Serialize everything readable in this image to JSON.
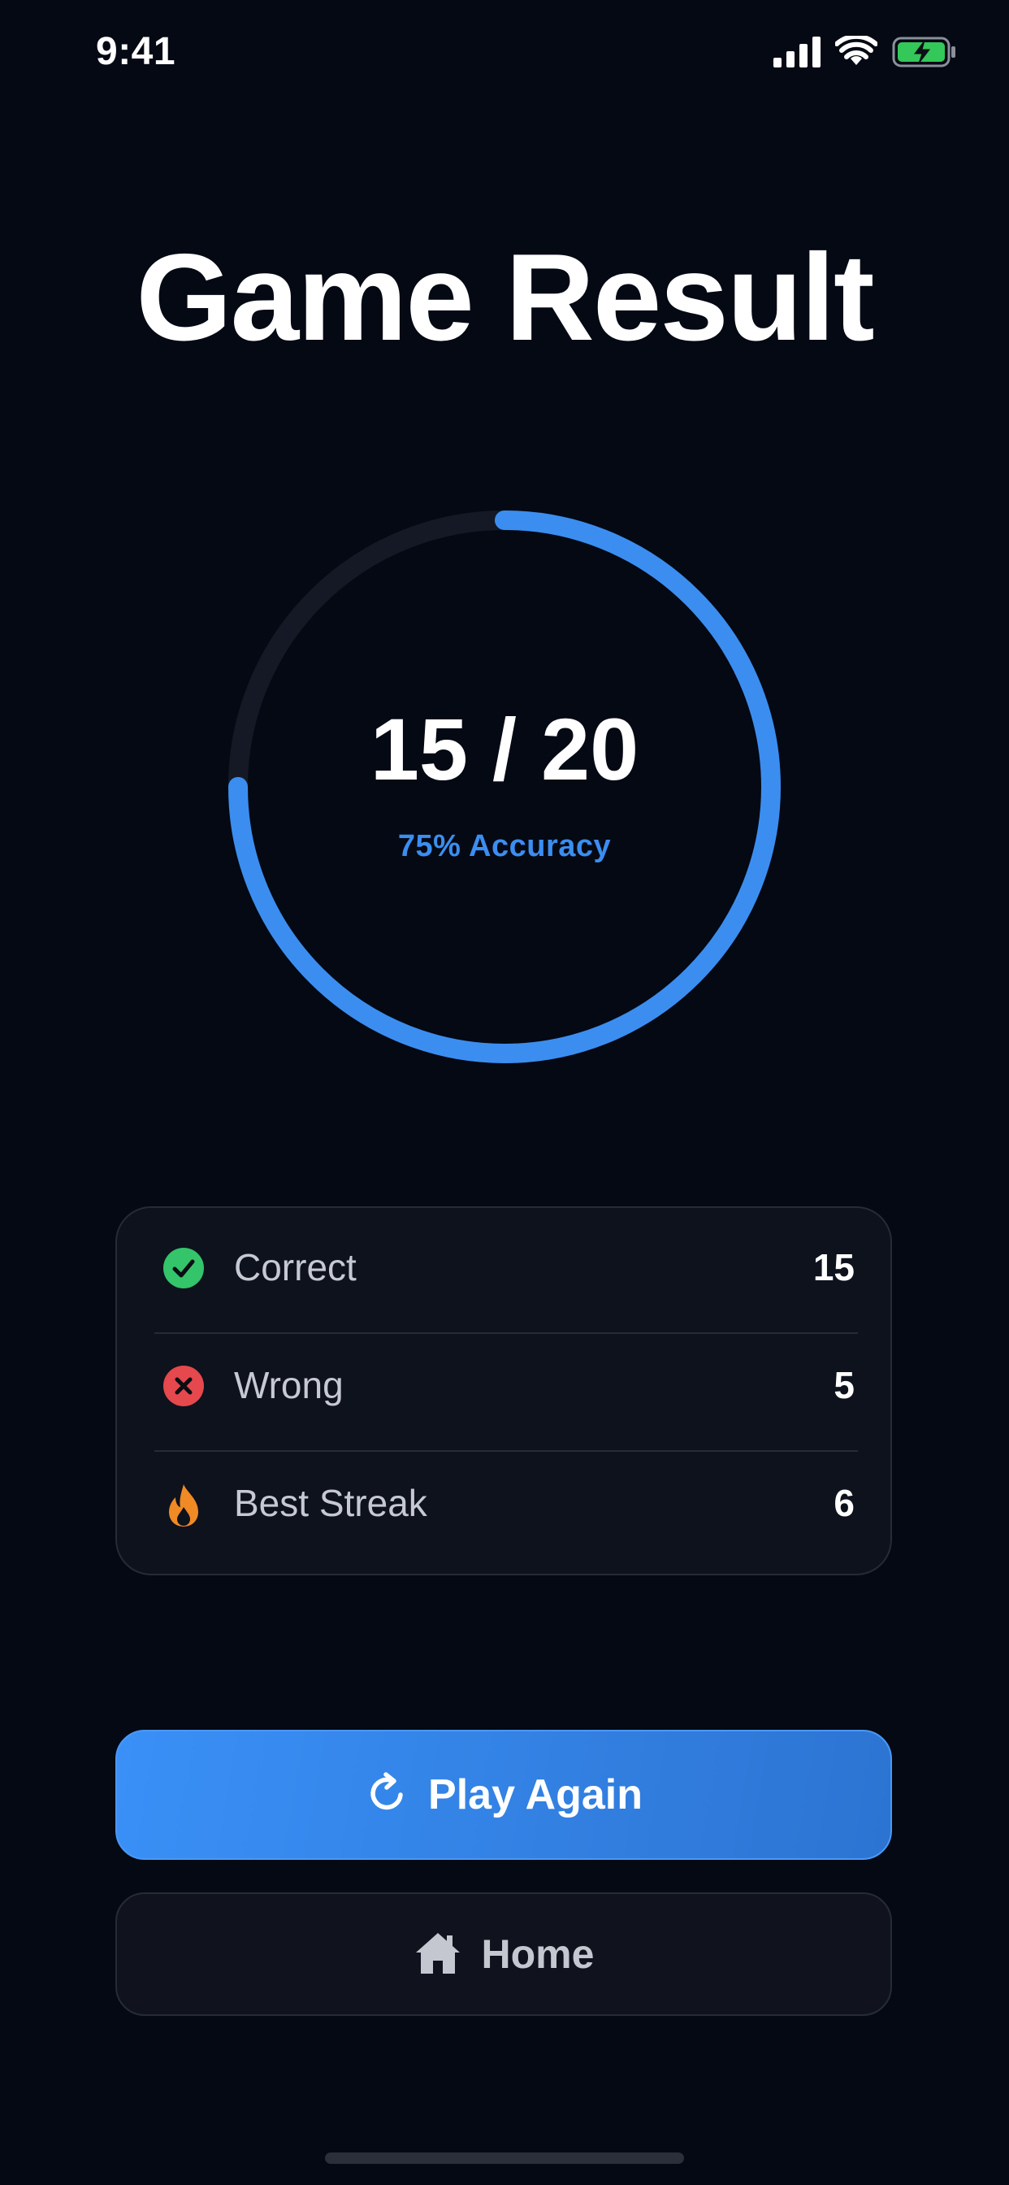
{
  "status_bar": {
    "time": "9:41"
  },
  "title": "Game Result",
  "score": {
    "correct": 15,
    "total": 20,
    "display": "15 / 20",
    "accuracy_label": "75% Accuracy",
    "progress_fraction": 0.75
  },
  "stats": [
    {
      "icon": "check-circle-icon",
      "label": "Correct",
      "value": "15",
      "color": "#34c46a"
    },
    {
      "icon": "x-circle-icon",
      "label": "Wrong",
      "value": "5",
      "color": "#e5484d"
    },
    {
      "icon": "flame-icon",
      "label": "Best Streak",
      "value": "6",
      "color": "#f08a24"
    }
  ],
  "buttons": {
    "play_again": {
      "label": "Play Again",
      "icon": "refresh-icon"
    },
    "home": {
      "label": "Home",
      "icon": "house-icon"
    }
  },
  "colors": {
    "background": "#050914",
    "accent": "#3b8ef0",
    "card": "#0e121d",
    "ring_track": "#151a26"
  }
}
